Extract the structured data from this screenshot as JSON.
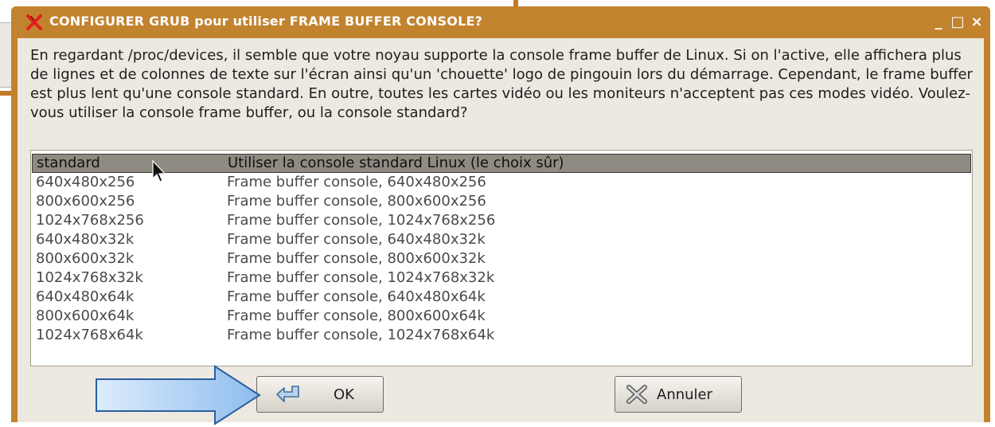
{
  "dialog": {
    "title": "CONFIGURER GRUB pour utiliser FRAME BUFFER CONSOLE?",
    "message": "En regardant /proc/devices, il semble que votre noyau supporte la console frame buffer de Linux. Si on l'active, elle affichera plus de lignes et de colonnes de texte sur l'écran ainsi qu'un 'chouette' logo de pingouin lors du démarrage. Cependant, le frame buffer est plus lent qu'une console standard. En outre, toutes les cartes vidéo ou les moniteurs n'acceptent pas ces modes vidéo. Voulez-vous utiliser la console frame buffer, ou la console standard?",
    "window_buttons": {
      "minimize": "_",
      "maximize": "□",
      "close": "×"
    }
  },
  "options": [
    {
      "key": "standard",
      "description": "Utiliser la console standard Linux (le choix sûr)"
    },
    {
      "key": "640x480x256",
      "description": "Frame buffer console, 640x480x256"
    },
    {
      "key": "800x600x256",
      "description": "Frame buffer console, 800x600x256"
    },
    {
      "key": "1024x768x256",
      "description": "Frame buffer console, 1024x768x256"
    },
    {
      "key": "640x480x32k",
      "description": "Frame buffer console, 640x480x32k"
    },
    {
      "key": "800x600x32k",
      "description": "Frame buffer console, 800x600x32k"
    },
    {
      "key": "1024x768x32k",
      "description": "Frame buffer console, 1024x768x32k"
    },
    {
      "key": "640x480x64k",
      "description": "Frame buffer console, 640x480x64k"
    },
    {
      "key": "800x600x64k",
      "description": "Frame buffer console, 800x600x64k"
    },
    {
      "key": "1024x768x64k",
      "description": "Frame buffer console, 1024x768x64k"
    }
  ],
  "selected_index": 0,
  "buttons": {
    "ok_label": "OK",
    "cancel_label": "Annuler"
  },
  "icons": {
    "app": "x-logo-icon",
    "ok": "enter-return-icon",
    "cancel": "cancel-x-icon",
    "pointer": "mouse-pointer-icon",
    "annotation": "arrow-right-icon"
  },
  "colors": {
    "titlebar": "#c2832f",
    "client_bg": "#ede9e1",
    "selection": "#908b82",
    "app_icon": "#e0211d",
    "annotation_arrow": "#a9cdf3"
  }
}
